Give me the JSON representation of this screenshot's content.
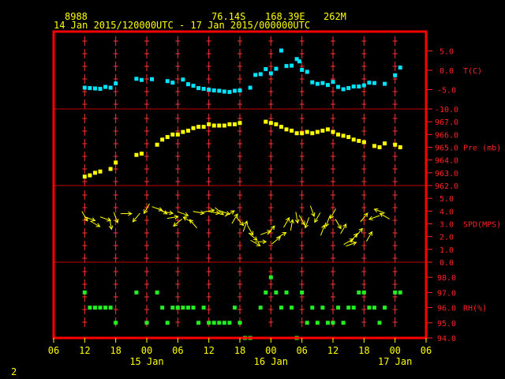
{
  "header": {
    "station_id": "8988",
    "latitude": "76.14S",
    "longitude": "168.39E",
    "elevation": "262M",
    "time_range": "14 Jan 2015/120000UTC - 17 Jan 2015/000000UTC",
    "footer_number": "2"
  },
  "colors": {
    "background": "#000000",
    "frame": "#ff0000",
    "panel_line": "#c00000",
    "grid": "#ff3333",
    "label": "#ffff00",
    "axis_red": "#ff2222",
    "temperature": "#00e5ff",
    "pressure": "#ffff00",
    "wind": "#ffff00",
    "humidity": "#22ee22"
  },
  "chart_data": {
    "type": "scatter",
    "x_axis": {
      "unit": "hours since 14 Jan 2015 00 UTC",
      "range": [
        6,
        78
      ],
      "tick_labels": [
        "06",
        "12",
        "18",
        "00",
        "06",
        "12",
        "18",
        "00",
        "06",
        "12",
        "18",
        "00",
        "06"
      ],
      "tick_values": [
        6,
        12,
        18,
        24,
        30,
        36,
        42,
        48,
        54,
        60,
        66,
        72,
        78
      ],
      "day_labels": [
        {
          "label": "15 Jan",
          "x": 24
        },
        {
          "label": "16 Jan",
          "x": 48
        },
        {
          "label": "17 Jan",
          "x": 72
        }
      ]
    },
    "grid": true,
    "panels": [
      {
        "name": "temperature",
        "label": "T(C)",
        "y_range": [
          -10,
          10
        ],
        "ticks": [
          -10,
          -5,
          0,
          5
        ],
        "tick_labels": [
          "-10.0",
          "-5.0",
          "0.0",
          "5.0"
        ],
        "label_at": 0,
        "color_key": "temperature",
        "points": [
          [
            12,
            -4.5
          ],
          [
            13,
            -4.6
          ],
          [
            14,
            -4.7
          ],
          [
            15,
            -4.8
          ],
          [
            16,
            -4.3
          ],
          [
            17,
            -4.5
          ],
          [
            18,
            -3.4
          ],
          [
            22,
            -2.2
          ],
          [
            23,
            -2.5
          ],
          [
            25,
            -2.3
          ],
          [
            28,
            -2.8
          ],
          [
            29,
            -3.2
          ],
          [
            31,
            -2.4
          ],
          [
            32,
            -3.6
          ],
          [
            33,
            -4.0
          ],
          [
            34,
            -4.6
          ],
          [
            35,
            -4.8
          ],
          [
            36,
            -5.0
          ],
          [
            37,
            -5.2
          ],
          [
            38,
            -5.3
          ],
          [
            39,
            -5.5
          ],
          [
            40,
            -5.6
          ],
          [
            41,
            -5.3
          ],
          [
            42,
            -5.2
          ],
          [
            44,
            -4.5
          ],
          [
            45,
            -1.2
          ],
          [
            46,
            -1.0
          ],
          [
            47,
            0.3
          ],
          [
            48,
            -0.8
          ],
          [
            49,
            0.4
          ],
          [
            50,
            5.1
          ],
          [
            51,
            1.1
          ],
          [
            52,
            1.2
          ],
          [
            53,
            2.9
          ],
          [
            53.5,
            2.3
          ],
          [
            54,
            0.1
          ],
          [
            55,
            -0.4
          ],
          [
            56,
            -3.1
          ],
          [
            57,
            -3.5
          ],
          [
            58,
            -3.3
          ],
          [
            59,
            -3.8
          ],
          [
            60,
            -3.0
          ],
          [
            61,
            -4.3
          ],
          [
            62,
            -4.9
          ],
          [
            63,
            -4.6
          ],
          [
            64,
            -4.2
          ],
          [
            65,
            -4.2
          ],
          [
            66,
            -3.9
          ],
          [
            67,
            -3.2
          ],
          [
            68,
            -3.3
          ],
          [
            70,
            -3.5
          ],
          [
            72,
            -1.3
          ],
          [
            73,
            0.7
          ]
        ]
      },
      {
        "name": "pressure",
        "label": "Pre (mb)",
        "y_range": [
          962,
          968
        ],
        "ticks": [
          962,
          963,
          964,
          965,
          966,
          967
        ],
        "tick_labels": [
          "962.0",
          "963.0",
          "964.0",
          "965.0",
          "966.0",
          "967.0"
        ],
        "label_at": 965,
        "color_key": "pressure",
        "points": [
          [
            12,
            962.7
          ],
          [
            13,
            962.8
          ],
          [
            14,
            963.0
          ],
          [
            15,
            963.1
          ],
          [
            17,
            963.3
          ],
          [
            18,
            963.8
          ],
          [
            22,
            964.4
          ],
          [
            23,
            964.5
          ],
          [
            26,
            965.2
          ],
          [
            27,
            965.6
          ],
          [
            28,
            965.8
          ],
          [
            29,
            966.0
          ],
          [
            30,
            966.0
          ],
          [
            31,
            966.2
          ],
          [
            32,
            966.3
          ],
          [
            33,
            966.5
          ],
          [
            34,
            966.6
          ],
          [
            35,
            966.6
          ],
          [
            36,
            966.8
          ],
          [
            37,
            966.7
          ],
          [
            38,
            966.7
          ],
          [
            39,
            966.7
          ],
          [
            40,
            966.8
          ],
          [
            41,
            966.8
          ],
          [
            42,
            966.9
          ],
          [
            47,
            967.0
          ],
          [
            48,
            966.9
          ],
          [
            49,
            966.8
          ],
          [
            50,
            966.6
          ],
          [
            51,
            966.4
          ],
          [
            52,
            966.3
          ],
          [
            53,
            966.1
          ],
          [
            54,
            966.1
          ],
          [
            55,
            966.2
          ],
          [
            56,
            966.1
          ],
          [
            57,
            966.2
          ],
          [
            58,
            966.3
          ],
          [
            59,
            966.4
          ],
          [
            60,
            966.2
          ],
          [
            61,
            966.0
          ],
          [
            62,
            965.9
          ],
          [
            63,
            965.8
          ],
          [
            64,
            965.6
          ],
          [
            65,
            965.5
          ],
          [
            66,
            965.4
          ],
          [
            68,
            965.1
          ],
          [
            69,
            965.0
          ],
          [
            70,
            965.3
          ],
          [
            72,
            965.2
          ],
          [
            73,
            965.0
          ]
        ]
      },
      {
        "name": "wind",
        "label": "SPD(MPS)",
        "y_range": [
          0,
          6
        ],
        "ticks": [
          0,
          1,
          2,
          3,
          4,
          5
        ],
        "tick_labels": [
          "0.0",
          "1.0",
          "2.0",
          "3.0",
          "4.0",
          "5.0"
        ],
        "label_at": 3,
        "color_key": "wind",
        "note": "dir = compass direction the arrow points (0 = up/north, 90 = right/east)",
        "points": [
          [
            12,
            3.6,
            150
          ],
          [
            13,
            3.4,
            110
          ],
          [
            14,
            3.0,
            120
          ],
          [
            16,
            3.4,
            110
          ],
          [
            17,
            3.0,
            170
          ],
          [
            18,
            3.5,
            160
          ],
          [
            20,
            3.8,
            90
          ],
          [
            22,
            3.5,
            220
          ],
          [
            24,
            4.2,
            210
          ],
          [
            26,
            4.2,
            110
          ],
          [
            27,
            4.0,
            120
          ],
          [
            28,
            3.9,
            100
          ],
          [
            29,
            3.5,
            80
          ],
          [
            30,
            3.1,
            230
          ],
          [
            31,
            3.8,
            110
          ],
          [
            32,
            3.3,
            300
          ],
          [
            33,
            3.0,
            320
          ],
          [
            34,
            3.9,
            100
          ],
          [
            36,
            4.0,
            80
          ],
          [
            37,
            3.9,
            100
          ],
          [
            38,
            4.0,
            130
          ],
          [
            39,
            3.9,
            110
          ],
          [
            40,
            3.8,
            60
          ],
          [
            41,
            3.4,
            30
          ],
          [
            42,
            3.2,
            140
          ],
          [
            43,
            2.8,
            20
          ],
          [
            44,
            2.5,
            150
          ],
          [
            44.5,
            2.0,
            130
          ],
          [
            45,
            1.5,
            120
          ],
          [
            46,
            1.6,
            90
          ],
          [
            47,
            2.3,
            70
          ],
          [
            48,
            2.5,
            40
          ],
          [
            49,
            1.7,
            50
          ],
          [
            50,
            2.1,
            60
          ],
          [
            51,
            3.1,
            30
          ],
          [
            52,
            2.9,
            10
          ],
          [
            53,
            3.5,
            170
          ],
          [
            54,
            3.3,
            150
          ],
          [
            55,
            3.1,
            200
          ],
          [
            56,
            4.0,
            160
          ],
          [
            57,
            3.5,
            210
          ],
          [
            58,
            2.5,
            20
          ],
          [
            59,
            3.2,
            200
          ],
          [
            60,
            3.8,
            210
          ],
          [
            61,
            3.0,
            150
          ],
          [
            62,
            2.6,
            30
          ],
          [
            63,
            1.6,
            60
          ],
          [
            63.5,
            1.4,
            70
          ],
          [
            64,
            1.9,
            40
          ],
          [
            65,
            2.3,
            40
          ],
          [
            66,
            3.5,
            40
          ],
          [
            67,
            2.0,
            30
          ],
          [
            68,
            3.5,
            250
          ],
          [
            69,
            4.0,
            290
          ],
          [
            70,
            3.6,
            300
          ]
        ]
      },
      {
        "name": "humidity",
        "label": "RH(%)",
        "y_range": [
          94,
          99
        ],
        "ticks": [
          94,
          95,
          96,
          97,
          98
        ],
        "tick_labels": [
          "94.0",
          "95.0",
          "96.0",
          "97.0",
          "98.0"
        ],
        "label_at": 96,
        "color_key": "humidity",
        "points": [
          [
            12,
            97
          ],
          [
            13,
            96
          ],
          [
            14,
            96
          ],
          [
            15,
            96
          ],
          [
            16,
            96
          ],
          [
            17,
            96
          ],
          [
            18,
            95
          ],
          [
            22,
            97
          ],
          [
            24,
            95
          ],
          [
            26,
            97
          ],
          [
            27,
            96
          ],
          [
            28,
            95
          ],
          [
            29,
            96
          ],
          [
            30,
            96
          ],
          [
            31,
            96
          ],
          [
            32,
            96
          ],
          [
            33,
            96
          ],
          [
            34,
            95
          ],
          [
            35,
            96
          ],
          [
            36,
            95
          ],
          [
            37,
            95
          ],
          [
            38,
            95
          ],
          [
            39,
            95
          ],
          [
            40,
            95
          ],
          [
            41,
            96
          ],
          [
            42,
            95
          ],
          [
            43,
            94
          ],
          [
            44,
            94
          ],
          [
            46,
            96
          ],
          [
            47,
            97
          ],
          [
            48,
            98
          ],
          [
            49,
            97
          ],
          [
            50,
            96
          ],
          [
            51,
            97
          ],
          [
            52,
            96
          ],
          [
            53,
            94
          ],
          [
            54,
            97
          ],
          [
            55,
            95
          ],
          [
            56,
            96
          ],
          [
            57,
            95
          ],
          [
            58,
            96
          ],
          [
            59,
            95
          ],
          [
            60,
            95
          ],
          [
            61,
            96
          ],
          [
            62,
            95
          ],
          [
            63,
            96
          ],
          [
            64,
            96
          ],
          [
            65,
            97
          ],
          [
            66,
            97
          ],
          [
            67,
            96
          ],
          [
            68,
            96
          ],
          [
            69,
            95
          ],
          [
            70,
            96
          ],
          [
            72,
            97
          ],
          [
            73,
            97
          ]
        ]
      }
    ]
  }
}
